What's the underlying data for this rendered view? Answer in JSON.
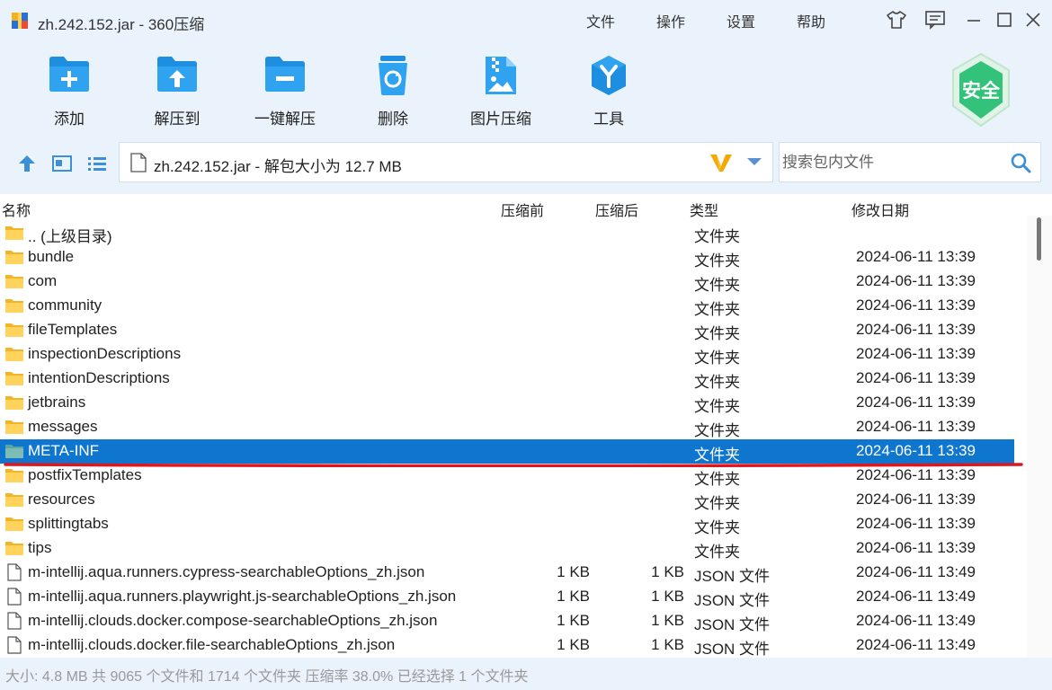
{
  "window": {
    "title": "zh.242.152.jar - 360压缩"
  },
  "menu": [
    "文件",
    "操作",
    "设置",
    "帮助"
  ],
  "toolbar": [
    {
      "label": "添加",
      "icon": "add-folder-icon"
    },
    {
      "label": "解压到",
      "icon": "extract-to-icon"
    },
    {
      "label": "一键解压",
      "icon": "quick-extract-icon"
    },
    {
      "label": "删除",
      "icon": "recycle-bin-icon"
    },
    {
      "label": "图片压缩",
      "icon": "image-compress-icon"
    },
    {
      "label": "工具",
      "icon": "tools-icon"
    }
  ],
  "safe_badge": "安全",
  "address": {
    "path": "zh.242.152.jar - 解包大小为 12.7 MB"
  },
  "search": {
    "placeholder": "搜索包内文件"
  },
  "columns": {
    "name": "名称",
    "before": "压缩前",
    "after": "压缩后",
    "type": "类型",
    "date": "修改日期"
  },
  "rows": [
    {
      "name": ".. (上级目录)",
      "before": "",
      "after": "",
      "type": "文件夹",
      "date": "",
      "kind": "folder"
    },
    {
      "name": "bundle",
      "before": "",
      "after": "",
      "type": "文件夹",
      "date": "2024-06-11 13:39",
      "kind": "folder"
    },
    {
      "name": "com",
      "before": "",
      "after": "",
      "type": "文件夹",
      "date": "2024-06-11 13:39",
      "kind": "folder"
    },
    {
      "name": "community",
      "before": "",
      "after": "",
      "type": "文件夹",
      "date": "2024-06-11 13:39",
      "kind": "folder"
    },
    {
      "name": "fileTemplates",
      "before": "",
      "after": "",
      "type": "文件夹",
      "date": "2024-06-11 13:39",
      "kind": "folder"
    },
    {
      "name": "inspectionDescriptions",
      "before": "",
      "after": "",
      "type": "文件夹",
      "date": "2024-06-11 13:39",
      "kind": "folder"
    },
    {
      "name": "intentionDescriptions",
      "before": "",
      "after": "",
      "type": "文件夹",
      "date": "2024-06-11 13:39",
      "kind": "folder"
    },
    {
      "name": "jetbrains",
      "before": "",
      "after": "",
      "type": "文件夹",
      "date": "2024-06-11 13:39",
      "kind": "folder"
    },
    {
      "name": "messages",
      "before": "",
      "after": "",
      "type": "文件夹",
      "date": "2024-06-11 13:39",
      "kind": "folder"
    },
    {
      "name": "META-INF",
      "before": "",
      "after": "",
      "type": "文件夹",
      "date": "2024-06-11 13:39",
      "kind": "folder",
      "selected": true
    },
    {
      "name": "postfixTemplates",
      "before": "",
      "after": "",
      "type": "文件夹",
      "date": "2024-06-11 13:39",
      "kind": "folder"
    },
    {
      "name": "resources",
      "before": "",
      "after": "",
      "type": "文件夹",
      "date": "2024-06-11 13:39",
      "kind": "folder"
    },
    {
      "name": "splittingtabs",
      "before": "",
      "after": "",
      "type": "文件夹",
      "date": "2024-06-11 13:39",
      "kind": "folder"
    },
    {
      "name": "tips",
      "before": "",
      "after": "",
      "type": "文件夹",
      "date": "2024-06-11 13:39",
      "kind": "folder"
    },
    {
      "name": "m-intellij.aqua.runners.cypress-searchableOptions_zh.json",
      "before": "1 KB",
      "after": "1 KB",
      "type": "JSON 文件",
      "date": "2024-06-11 13:49",
      "kind": "file"
    },
    {
      "name": "m-intellij.aqua.runners.playwright.js-searchableOptions_zh.json",
      "before": "1 KB",
      "after": "1 KB",
      "type": "JSON 文件",
      "date": "2024-06-11 13:49",
      "kind": "file"
    },
    {
      "name": "m-intellij.clouds.docker.compose-searchableOptions_zh.json",
      "before": "1 KB",
      "after": "1 KB",
      "type": "JSON 文件",
      "date": "2024-06-11 13:49",
      "kind": "file"
    },
    {
      "name": "m-intellij.clouds.docker.file-searchableOptions_zh.json",
      "before": "1 KB",
      "after": "1 KB",
      "type": "JSON 文件",
      "date": "2024-06-11 13:49",
      "kind": "file"
    }
  ],
  "status": "大小: 4.8 MB 共 9065 个文件和 1714 个文件夹 压缩率 38.0% 已经选择 1 个文件夹",
  "colors": {
    "accent": "#0f76d0",
    "tool_blue": "#1e8fe0",
    "safe_green": "#33c27a",
    "annotation_red": "#e0161f"
  }
}
